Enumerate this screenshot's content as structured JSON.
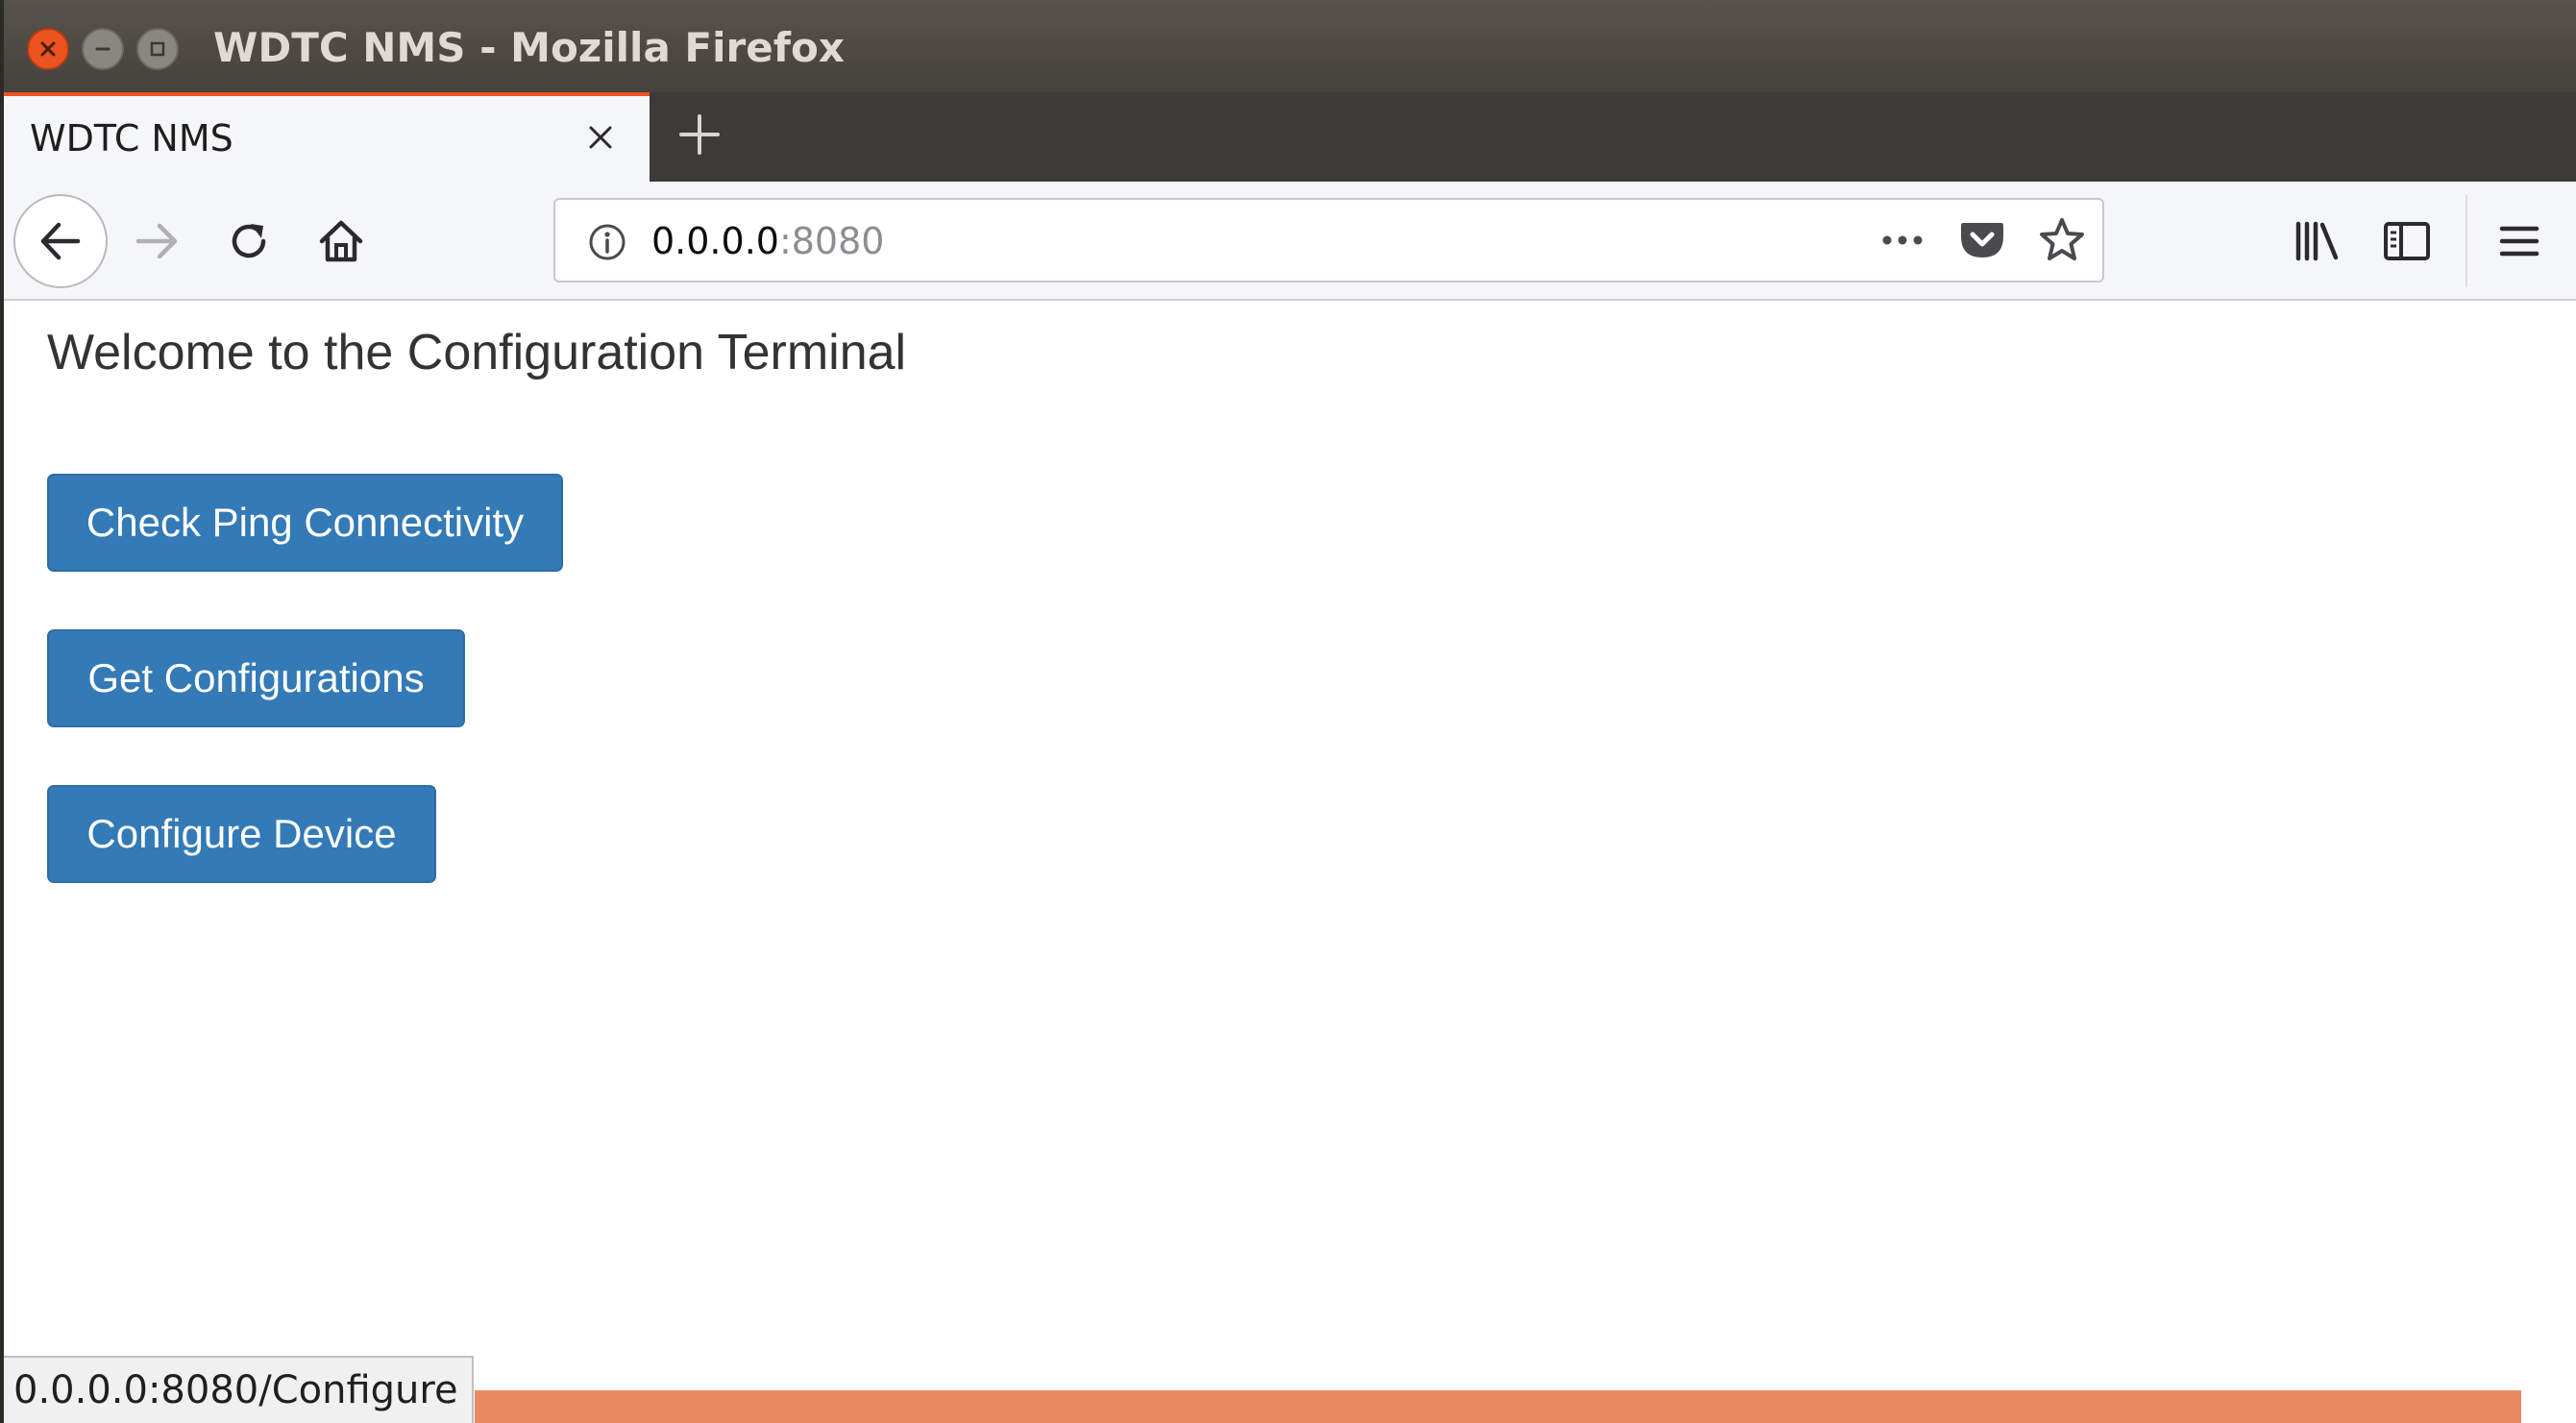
{
  "window": {
    "title": "WDTC NMS - Mozilla Firefox"
  },
  "tabs": [
    {
      "label": "WDTC NMS",
      "active": true
    }
  ],
  "urlbar": {
    "host": "0.0.0.0",
    "port": ":8080"
  },
  "icons": {
    "close": "close-icon",
    "minimize": "minimize-icon",
    "maximize": "maximize-icon",
    "tab_close": "tab-close-icon",
    "new_tab": "plus-icon",
    "back": "arrow-left-icon",
    "forward": "arrow-right-icon",
    "reload": "reload-icon",
    "home": "home-icon",
    "site_info": "info-icon",
    "page_actions": "more-horizontal-icon",
    "pocket": "pocket-icon",
    "bookmark": "star-icon",
    "library": "library-icon",
    "sidebar": "sidebar-icon",
    "menu": "hamburger-menu-icon"
  },
  "colors": {
    "accent": "#e95420",
    "button_primary": "#337ab7",
    "button_border": "#2e6da4",
    "loading_bar": "#ea8a62"
  },
  "page": {
    "heading": "Welcome to the Configuration Terminal",
    "buttons": [
      {
        "label": "Check Ping Connectivity"
      },
      {
        "label": "Get Configurations"
      },
      {
        "label": "Configure Device"
      }
    ]
  },
  "status": {
    "link_preview": "0.0.0.0:8080/Configure"
  }
}
